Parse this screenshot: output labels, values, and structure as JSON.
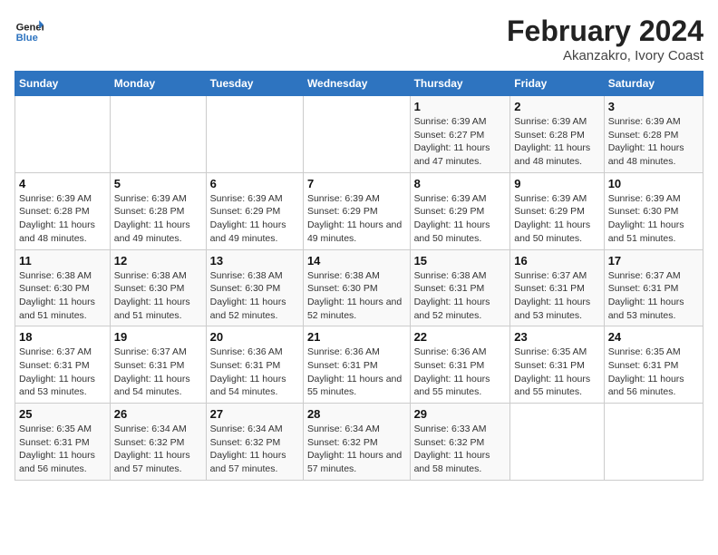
{
  "header": {
    "logo_text_general": "General",
    "logo_text_blue": "Blue",
    "title": "February 2024",
    "subtitle": "Akanzakro, Ivory Coast"
  },
  "days_of_week": [
    "Sunday",
    "Monday",
    "Tuesday",
    "Wednesday",
    "Thursday",
    "Friday",
    "Saturday"
  ],
  "weeks": [
    [
      {
        "day": "",
        "info": ""
      },
      {
        "day": "",
        "info": ""
      },
      {
        "day": "",
        "info": ""
      },
      {
        "day": "",
        "info": ""
      },
      {
        "day": "1",
        "info": "Sunrise: 6:39 AM\nSunset: 6:27 PM\nDaylight: 11 hours and 47 minutes."
      },
      {
        "day": "2",
        "info": "Sunrise: 6:39 AM\nSunset: 6:28 PM\nDaylight: 11 hours and 48 minutes."
      },
      {
        "day": "3",
        "info": "Sunrise: 6:39 AM\nSunset: 6:28 PM\nDaylight: 11 hours and 48 minutes."
      }
    ],
    [
      {
        "day": "4",
        "info": "Sunrise: 6:39 AM\nSunset: 6:28 PM\nDaylight: 11 hours and 48 minutes."
      },
      {
        "day": "5",
        "info": "Sunrise: 6:39 AM\nSunset: 6:28 PM\nDaylight: 11 hours and 49 minutes."
      },
      {
        "day": "6",
        "info": "Sunrise: 6:39 AM\nSunset: 6:29 PM\nDaylight: 11 hours and 49 minutes."
      },
      {
        "day": "7",
        "info": "Sunrise: 6:39 AM\nSunset: 6:29 PM\nDaylight: 11 hours and 49 minutes."
      },
      {
        "day": "8",
        "info": "Sunrise: 6:39 AM\nSunset: 6:29 PM\nDaylight: 11 hours and 50 minutes."
      },
      {
        "day": "9",
        "info": "Sunrise: 6:39 AM\nSunset: 6:29 PM\nDaylight: 11 hours and 50 minutes."
      },
      {
        "day": "10",
        "info": "Sunrise: 6:39 AM\nSunset: 6:30 PM\nDaylight: 11 hours and 51 minutes."
      }
    ],
    [
      {
        "day": "11",
        "info": "Sunrise: 6:38 AM\nSunset: 6:30 PM\nDaylight: 11 hours and 51 minutes."
      },
      {
        "day": "12",
        "info": "Sunrise: 6:38 AM\nSunset: 6:30 PM\nDaylight: 11 hours and 51 minutes."
      },
      {
        "day": "13",
        "info": "Sunrise: 6:38 AM\nSunset: 6:30 PM\nDaylight: 11 hours and 52 minutes."
      },
      {
        "day": "14",
        "info": "Sunrise: 6:38 AM\nSunset: 6:30 PM\nDaylight: 11 hours and 52 minutes."
      },
      {
        "day": "15",
        "info": "Sunrise: 6:38 AM\nSunset: 6:31 PM\nDaylight: 11 hours and 52 minutes."
      },
      {
        "day": "16",
        "info": "Sunrise: 6:37 AM\nSunset: 6:31 PM\nDaylight: 11 hours and 53 minutes."
      },
      {
        "day": "17",
        "info": "Sunrise: 6:37 AM\nSunset: 6:31 PM\nDaylight: 11 hours and 53 minutes."
      }
    ],
    [
      {
        "day": "18",
        "info": "Sunrise: 6:37 AM\nSunset: 6:31 PM\nDaylight: 11 hours and 53 minutes."
      },
      {
        "day": "19",
        "info": "Sunrise: 6:37 AM\nSunset: 6:31 PM\nDaylight: 11 hours and 54 minutes."
      },
      {
        "day": "20",
        "info": "Sunrise: 6:36 AM\nSunset: 6:31 PM\nDaylight: 11 hours and 54 minutes."
      },
      {
        "day": "21",
        "info": "Sunrise: 6:36 AM\nSunset: 6:31 PM\nDaylight: 11 hours and 55 minutes."
      },
      {
        "day": "22",
        "info": "Sunrise: 6:36 AM\nSunset: 6:31 PM\nDaylight: 11 hours and 55 minutes."
      },
      {
        "day": "23",
        "info": "Sunrise: 6:35 AM\nSunset: 6:31 PM\nDaylight: 11 hours and 55 minutes."
      },
      {
        "day": "24",
        "info": "Sunrise: 6:35 AM\nSunset: 6:31 PM\nDaylight: 11 hours and 56 minutes."
      }
    ],
    [
      {
        "day": "25",
        "info": "Sunrise: 6:35 AM\nSunset: 6:31 PM\nDaylight: 11 hours and 56 minutes."
      },
      {
        "day": "26",
        "info": "Sunrise: 6:34 AM\nSunset: 6:32 PM\nDaylight: 11 hours and 57 minutes."
      },
      {
        "day": "27",
        "info": "Sunrise: 6:34 AM\nSunset: 6:32 PM\nDaylight: 11 hours and 57 minutes."
      },
      {
        "day": "28",
        "info": "Sunrise: 6:34 AM\nSunset: 6:32 PM\nDaylight: 11 hours and 57 minutes."
      },
      {
        "day": "29",
        "info": "Sunrise: 6:33 AM\nSunset: 6:32 PM\nDaylight: 11 hours and 58 minutes."
      },
      {
        "day": "",
        "info": ""
      },
      {
        "day": "",
        "info": ""
      }
    ]
  ]
}
